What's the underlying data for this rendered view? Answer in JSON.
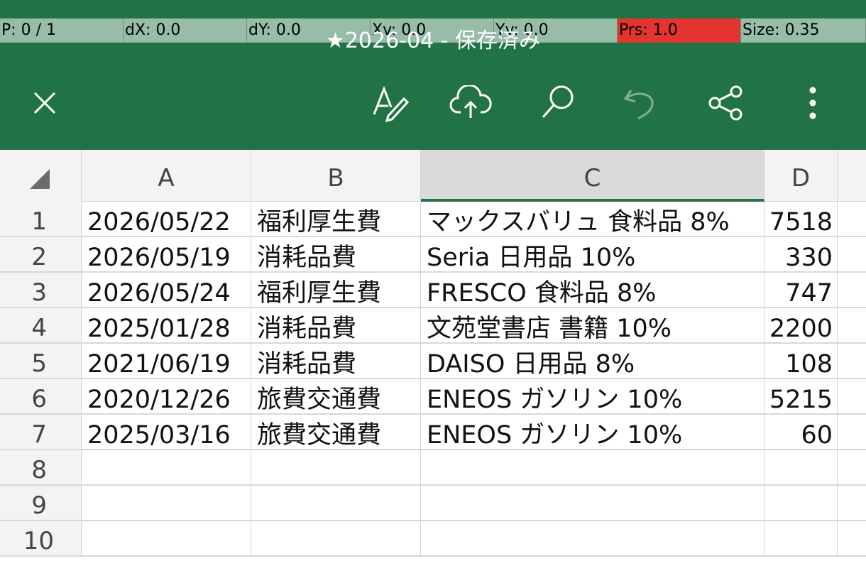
{
  "overlay": {
    "p": "P: 0 / 1",
    "dx": "dX: 0.0",
    "dy": "dY: 0.0",
    "xv": "Xv: 0.0",
    "yv": "Yv: 0.0",
    "prs": "Prs: 1.0",
    "size": "Size: 0.35"
  },
  "header": {
    "title": "★2026-04 - 保存済み",
    "icons": [
      "close-icon",
      "pen-edit-icon",
      "cloud-upload-icon",
      "search-icon",
      "undo-icon",
      "share-icon",
      "more-icon"
    ]
  },
  "colors": {
    "accent": "#217346",
    "header_bg": "#f3f3f3",
    "overlay_green": "#97bca8",
    "overlay_red": "#e3342f"
  },
  "sheet": {
    "columns": [
      "A",
      "B",
      "C",
      "D"
    ],
    "selected_column": "C",
    "rows": [
      {
        "num": "1",
        "a": "2026/05/22",
        "b": "福利厚生費",
        "c": "マックスバリュ 食料品 8%",
        "d": "7518"
      },
      {
        "num": "2",
        "a": "2026/05/19",
        "b": "消耗品費",
        "c": "Seria 日用品 10%",
        "d": "330"
      },
      {
        "num": "3",
        "a": "2026/05/24",
        "b": "福利厚生費",
        "c": "FRESCO 食料品 8%",
        "d": "747"
      },
      {
        "num": "4",
        "a": "2025/01/28",
        "b": "消耗品費",
        "c": "文苑堂書店 書籍 10%",
        "d": "2200"
      },
      {
        "num": "5",
        "a": "2021/06/19",
        "b": "消耗品費",
        "c": "DAISO 日用品 8%",
        "d": "108"
      },
      {
        "num": "6",
        "a": "2020/12/26",
        "b": "旅費交通費",
        "c": "ENEOS ガソリン 10%",
        "d": "5215"
      },
      {
        "num": "7",
        "a": "2025/03/16",
        "b": "旅費交通費",
        "c": "ENEOS ガソリン 10%",
        "d": "60"
      },
      {
        "num": "8",
        "a": "",
        "b": "",
        "c": "",
        "d": ""
      },
      {
        "num": "9",
        "a": "",
        "b": "",
        "c": "",
        "d": ""
      },
      {
        "num": "10",
        "a": "",
        "b": "",
        "c": "",
        "d": ""
      }
    ]
  }
}
